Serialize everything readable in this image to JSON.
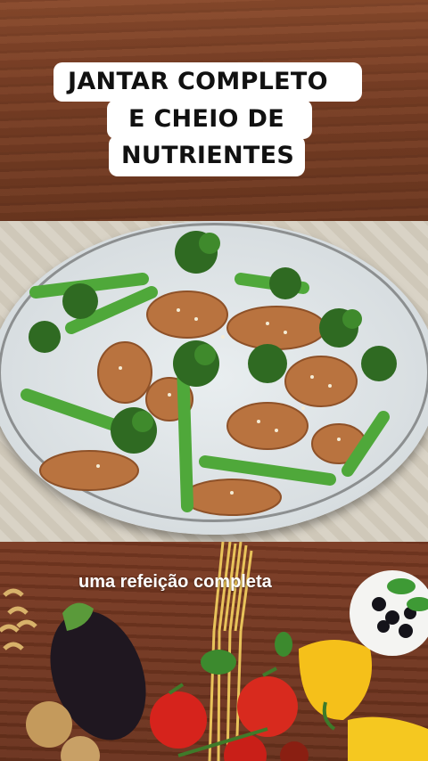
{
  "headline": {
    "line1": "JANTAR COMPLETO",
    "line2": "E CHEIO DE",
    "line3": "NUTRIENTES"
  },
  "caption": "uma refeição completa",
  "images": {
    "dish": "broccoli-chicken-plate-photo",
    "ingredients": "vegetables-pasta-photo"
  }
}
